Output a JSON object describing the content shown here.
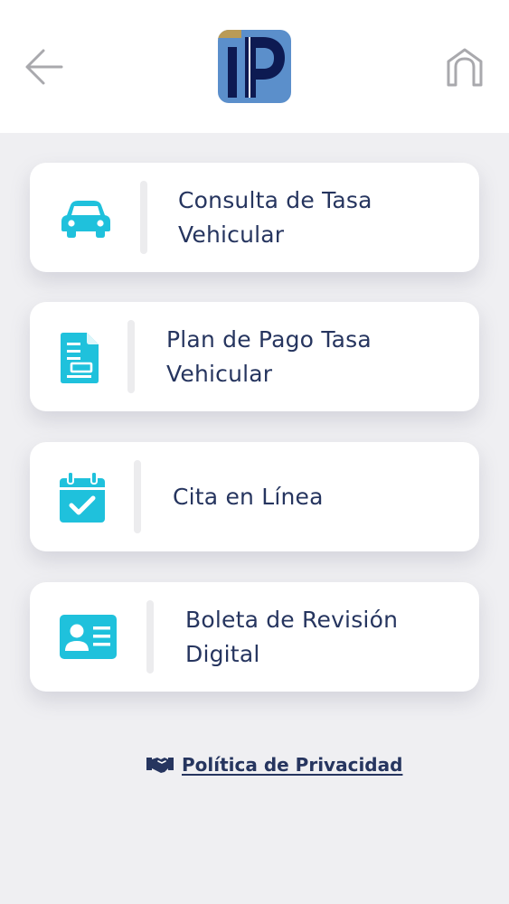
{
  "header": {
    "back_icon": "arrow-left-icon",
    "home_icon": "home-icon",
    "logo": "ip-logo"
  },
  "menu": [
    {
      "label": "Consulta de Tasa Vehicular",
      "icon": "car-icon"
    },
    {
      "label": "Plan de Pago Tasa Vehicular",
      "icon": "document-icon"
    },
    {
      "label": "Cita en Línea",
      "icon": "calendar-check-icon"
    },
    {
      "label": "Boleta de Revisión Digital",
      "icon": "id-card-icon"
    }
  ],
  "footer": {
    "privacy_label": "Política de Privacidad",
    "privacy_icon": "handshake-icon"
  },
  "colors": {
    "accent": "#1fc1dc",
    "text": "#26355f",
    "background": "#efeff2",
    "logo_blue": "#5b8fcb",
    "logo_navy": "#0d1a52",
    "logo_gold": "#b99b57"
  }
}
